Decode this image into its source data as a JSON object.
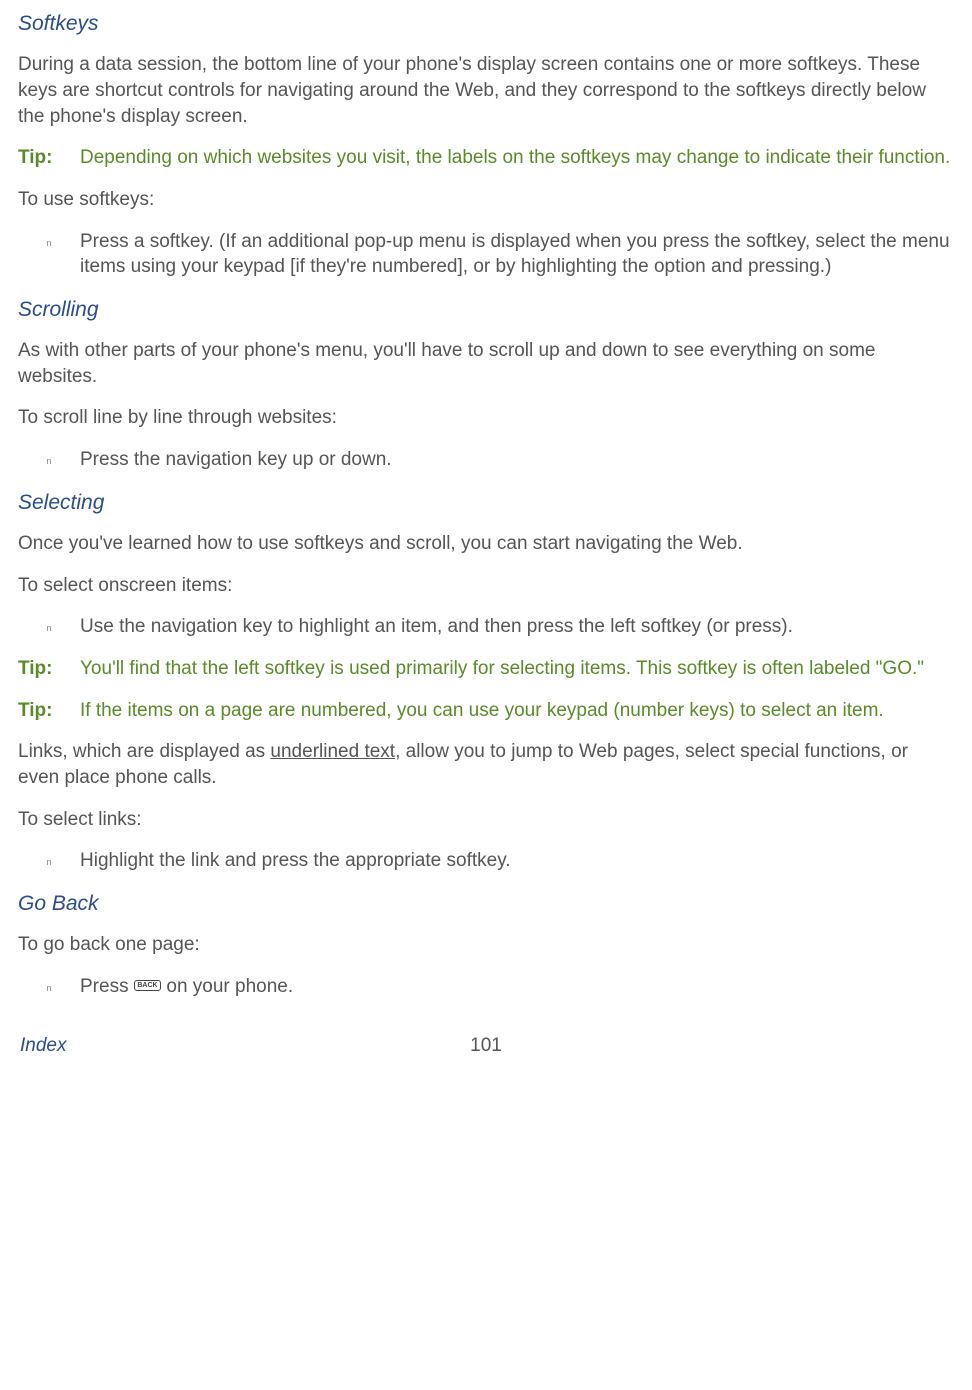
{
  "sections": {
    "softkeys": {
      "heading": "Softkeys",
      "para1": "During a data session, the bottom line of your phone's display screen contains one or more softkeys. These keys are shortcut controls for navigating around the Web, and they correspond to the softkeys directly below the phone's display screen.",
      "tip_label": "Tip:",
      "tip_text": "Depending on which websites you visit, the labels on the softkeys may change to indicate their function.",
      "intro": "To use softkeys:",
      "item1": "Press a softkey. (If an additional pop-up menu is displayed when you press the softkey, select the menu items using your keypad [if they're numbered], or by highlighting the option and pressing.)"
    },
    "scrolling": {
      "heading": "Scrolling",
      "para1": "As with other parts of your phone's menu, you'll have to scroll up and down to see everything on some websites.",
      "intro": "To scroll line by line through websites:",
      "item1": "Press the navigation key up or down."
    },
    "selecting": {
      "heading": "Selecting",
      "para1": "Once you've learned how to use softkeys and scroll, you can start navigating the Web.",
      "intro": "To select onscreen items:",
      "item1": "Use the navigation key to highlight an item, and then press the left softkey (or press).",
      "tip1_label": "Tip:",
      "tip1_text": "You'll find that the left softkey is used primarily for selecting items. This softkey is often labeled \"GO.\"",
      "tip2_label": "Tip:",
      "tip2_text": "If the items on a page are numbered, you can use your keypad (number keys) to select an item.",
      "links_para_pre": "Links, which are displayed as ",
      "links_para_underlined": "underlined text",
      "links_para_post": ", allow you to jump to Web pages, select special functions, or even place phone calls.",
      "intro2": "To select links:",
      "item2": "Highlight the link and press the appropriate softkey."
    },
    "goback": {
      "heading": "Go Back",
      "intro": "To go back one page:",
      "item_pre": "Press ",
      "icon_label": "BACK",
      "item_post": " on your phone."
    }
  },
  "footer": {
    "left": "Index",
    "center": "101"
  }
}
